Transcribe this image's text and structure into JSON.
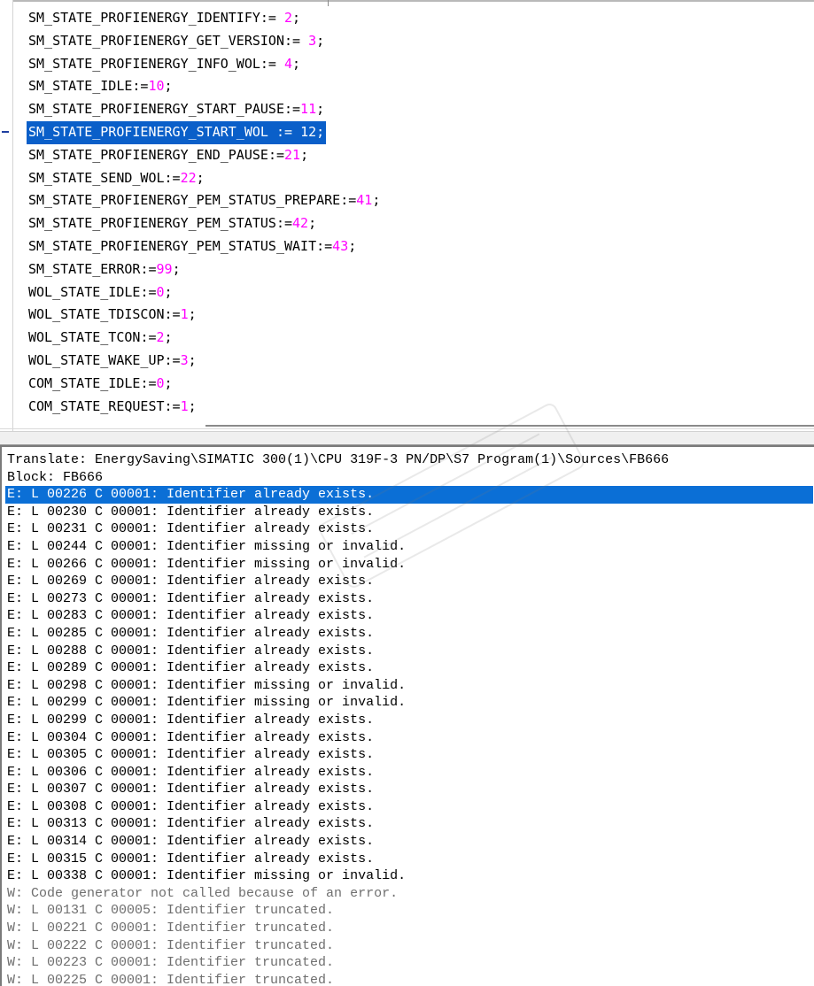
{
  "editor": {
    "lines": [
      {
        "name": "SM_STATE_PROFIENERGY_IDENTIFY",
        "sep": ":= ",
        "value": "2",
        "end": ";"
      },
      {
        "name": "SM_STATE_PROFIENERGY_GET_VERSION",
        "sep": ":= ",
        "value": "3",
        "end": ";"
      },
      {
        "name": "SM_STATE_PROFIENERGY_INFO_WOL",
        "sep": ":= ",
        "value": "4",
        "end": ";"
      },
      {
        "name": "SM_STATE_IDLE",
        "sep": ":=",
        "value": "10",
        "end": ";"
      },
      {
        "name": "SM_STATE_PROFIENERGY_START_PAUSE",
        "sep": ":=",
        "value": "11",
        "end": ";"
      },
      {
        "name": "SM_STATE_PROFIENERGY_START_WOL",
        "sep": " := ",
        "value": "12",
        "end": ";",
        "selected": true
      },
      {
        "name": "SM_STATE_PROFIENERGY_END_PAUSE",
        "sep": ":=",
        "value": "21",
        "end": ";"
      },
      {
        "name": "SM_STATE_SEND_WOL",
        "sep": ":=",
        "value": "22",
        "end": ";"
      },
      {
        "name": "SM_STATE_PROFIENERGY_PEM_STATUS_PREPARE",
        "sep": ":=",
        "value": "41",
        "end": ";"
      },
      {
        "name": "SM_STATE_PROFIENERGY_PEM_STATUS",
        "sep": ":=",
        "value": "42",
        "end": ";"
      },
      {
        "name": "SM_STATE_PROFIENERGY_PEM_STATUS_WAIT",
        "sep": ":=",
        "value": "43",
        "end": ";"
      },
      {
        "name": "SM_STATE_ERROR",
        "sep": ":=",
        "value": "99",
        "end": ";"
      },
      {
        "name": "WOL_STATE_IDLE",
        "sep": ":=",
        "value": "0",
        "end": ";"
      },
      {
        "name": "WOL_STATE_TDISCON",
        "sep": ":=",
        "value": "1",
        "end": ";"
      },
      {
        "name": "WOL_STATE_TCON",
        "sep": ":=",
        "value": "2",
        "end": ";"
      },
      {
        "name": "WOL_STATE_WAKE_UP",
        "sep": ":=",
        "value": "3",
        "end": ";"
      },
      {
        "name": "COM_STATE_IDLE",
        "sep": ":=",
        "value": "0",
        "end": ";"
      },
      {
        "name": "COM_STATE_REQUEST",
        "sep": ":=",
        "value": "1",
        "end": ";"
      }
    ]
  },
  "output": {
    "lines": [
      {
        "text": "Translate: EnergySaving\\SIMATIC 300(1)\\CPU 319F-3 PN/DP\\S7 Program(1)\\Sources\\FB666",
        "type": "info"
      },
      {
        "text": "Block: FB666",
        "type": "info"
      },
      {
        "text": "E: L 00226 C 00001: Identifier already exists.",
        "type": "error",
        "selected": true
      },
      {
        "text": "E: L 00230 C 00001: Identifier already exists.",
        "type": "error"
      },
      {
        "text": "E: L 00231 C 00001: Identifier already exists.",
        "type": "error"
      },
      {
        "text": "E: L 00244 C 00001: Identifier missing or invalid.",
        "type": "error"
      },
      {
        "text": "E: L 00266 C 00001: Identifier missing or invalid.",
        "type": "error"
      },
      {
        "text": "E: L 00269 C 00001: Identifier already exists.",
        "type": "error"
      },
      {
        "text": "E: L 00273 C 00001: Identifier already exists.",
        "type": "error"
      },
      {
        "text": "E: L 00283 C 00001: Identifier already exists.",
        "type": "error"
      },
      {
        "text": "E: L 00285 C 00001: Identifier already exists.",
        "type": "error"
      },
      {
        "text": "E: L 00288 C 00001: Identifier already exists.",
        "type": "error"
      },
      {
        "text": "E: L 00289 C 00001: Identifier already exists.",
        "type": "error"
      },
      {
        "text": "E: L 00298 C 00001: Identifier missing or invalid.",
        "type": "error"
      },
      {
        "text": "E: L 00299 C 00001: Identifier missing or invalid.",
        "type": "error"
      },
      {
        "text": "E: L 00299 C 00001: Identifier already exists.",
        "type": "error"
      },
      {
        "text": "E: L 00304 C 00001: Identifier already exists.",
        "type": "error"
      },
      {
        "text": "E: L 00305 C 00001: Identifier already exists.",
        "type": "error"
      },
      {
        "text": "E: L 00306 C 00001: Identifier already exists.",
        "type": "error"
      },
      {
        "text": "E: L 00307 C 00001: Identifier already exists.",
        "type": "error"
      },
      {
        "text": "E: L 00308 C 00001: Identifier already exists.",
        "type": "error"
      },
      {
        "text": "E: L 00313 C 00001: Identifier already exists.",
        "type": "error"
      },
      {
        "text": "E: L 00314 C 00001: Identifier already exists.",
        "type": "error"
      },
      {
        "text": "E: L 00315 C 00001: Identifier already exists.",
        "type": "error"
      },
      {
        "text": "E: L 00338 C 00001: Identifier missing or invalid.",
        "type": "error"
      },
      {
        "text": "W: Code generator not called because of an error.",
        "type": "warning"
      },
      {
        "text": "W: L 00131 C 00005: Identifier truncated.",
        "type": "warning"
      },
      {
        "text": "W: L 00221 C 00001: Identifier truncated.",
        "type": "warning"
      },
      {
        "text": "W: L 00222 C 00001: Identifier truncated.",
        "type": "warning"
      },
      {
        "text": "W: L 00223 C 00001: Identifier truncated.",
        "type": "warning"
      },
      {
        "text": "W: L 00225 C 00001: Identifier truncated.",
        "type": "warning"
      }
    ]
  },
  "colors": {
    "number": "#ff00ff",
    "selection_editor": "#0a5fc9",
    "selection_output": "#0b6fd6",
    "warning_text": "#6f6f6f"
  }
}
